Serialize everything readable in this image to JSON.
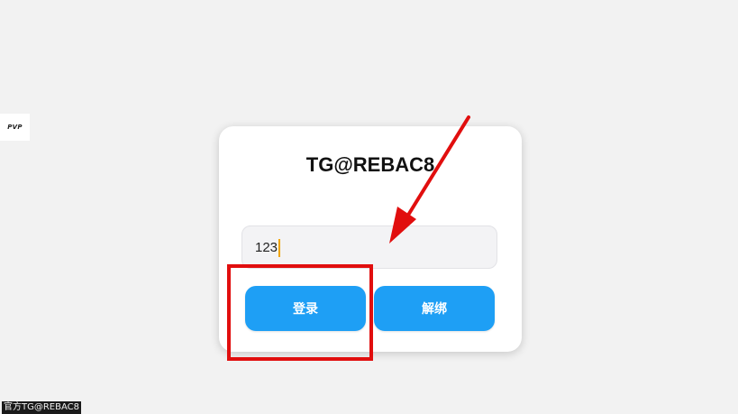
{
  "side_logo": {
    "text": "PVP"
  },
  "card": {
    "title": "TG@REBAC8",
    "input": {
      "value": "123",
      "placeholder": ""
    },
    "buttons": {
      "login_label": "登录",
      "unbind_label": "解绑"
    }
  },
  "footer": {
    "tag": "官方TG@REBAC8"
  },
  "colors": {
    "background": "#f2f2f2",
    "button": "#1e9ff5",
    "highlight": "#e10e0e",
    "caret": "#f0a500"
  }
}
